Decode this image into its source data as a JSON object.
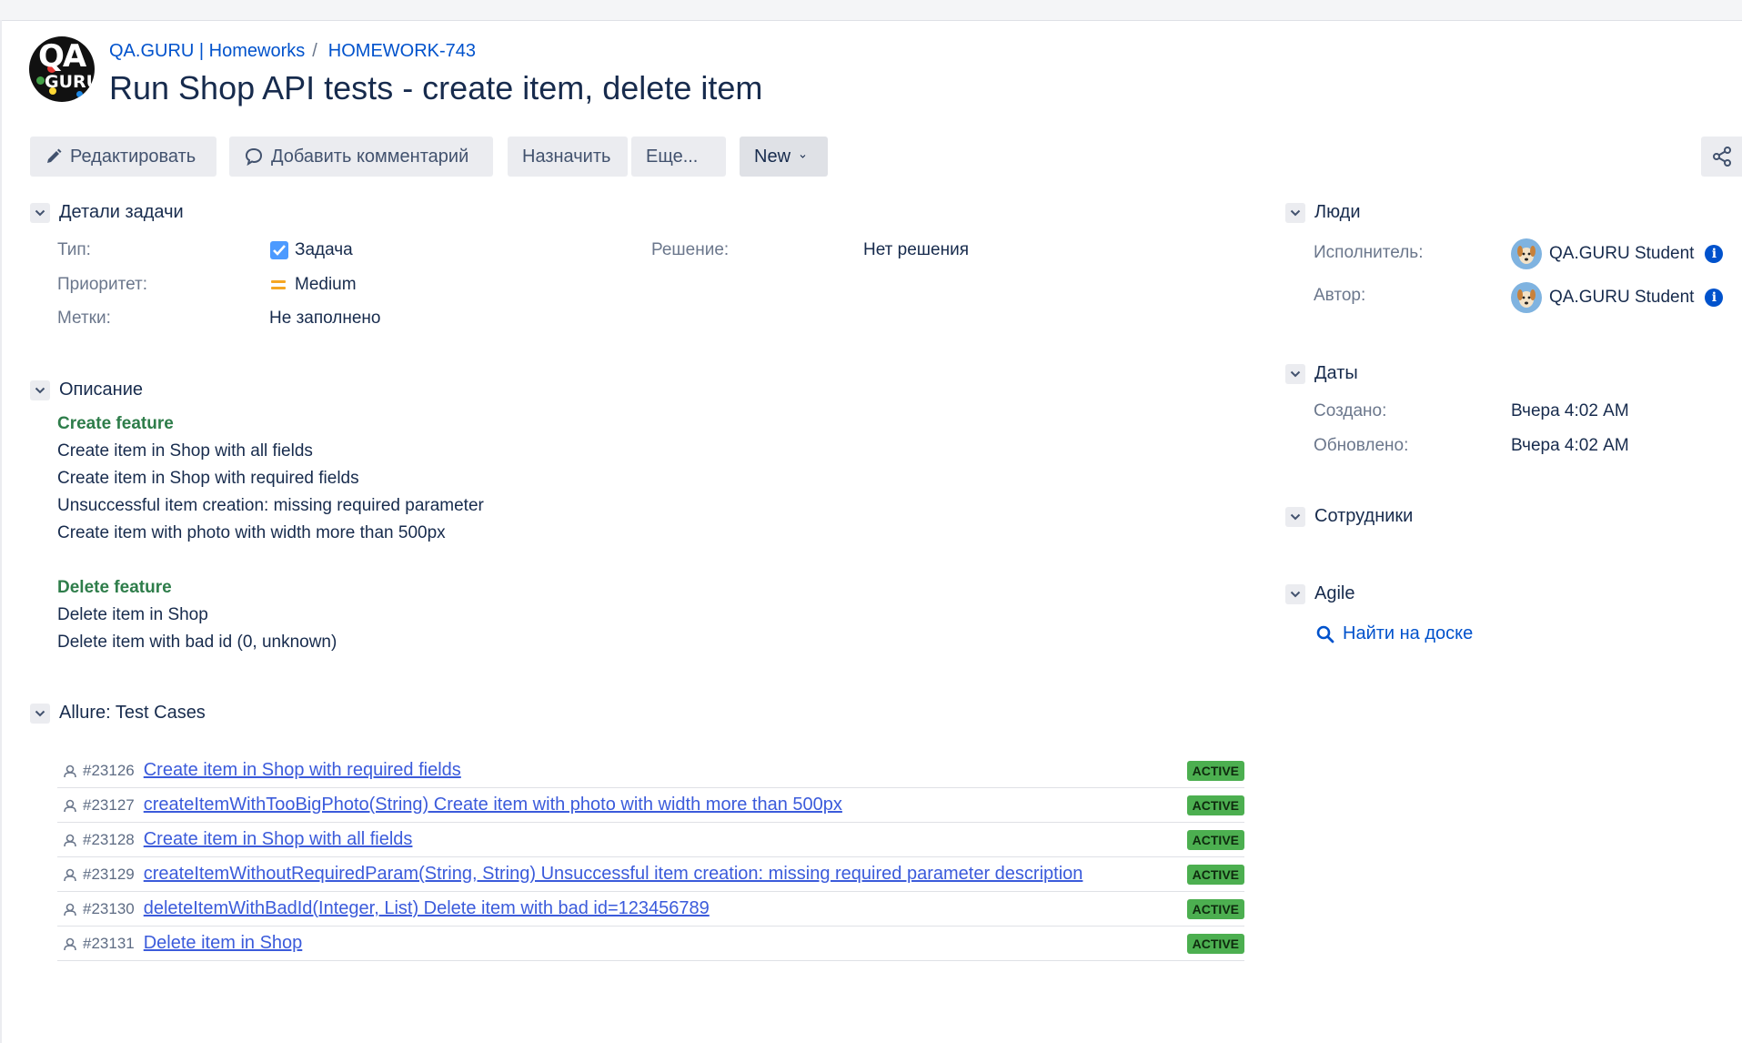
{
  "header": {
    "project": "QA.GURU | Homeworks",
    "separator": "/",
    "issue_key": "HOMEWORK-743",
    "title": "Run Shop API tests - create item, delete item",
    "logo_text_top": "QA",
    "logo_text_bottom": "GURU"
  },
  "toolbar": {
    "edit": "Редактировать",
    "comment": "Добавить комментарий",
    "assign": "Назначить",
    "more": "Еще...",
    "status": "New"
  },
  "details": {
    "header": "Детали задачи",
    "type_label": "Тип:",
    "type_value": "Задача",
    "priority_label": "Приоритет:",
    "priority_value": "Medium",
    "labels_label": "Метки:",
    "labels_value": "Не заполнено",
    "resolution_label": "Решение:",
    "resolution_value": "Нет решения"
  },
  "description": {
    "header": "Описание",
    "create_title": "Create feature",
    "create_lines": [
      "Create item in Shop with all fields",
      "Create item in Shop with required fields",
      "Unsuccessful item creation: missing required parameter",
      "Create item with photo with width more than 500px"
    ],
    "delete_title": "Delete feature",
    "delete_lines": [
      "Delete item in Shop",
      "Delete item with bad id (0, unknown)"
    ]
  },
  "allure": {
    "header": "Allure: Test Cases",
    "rows": [
      {
        "id": "#23126",
        "name": "Create item in Shop with required fields",
        "status": "ACTIVE"
      },
      {
        "id": "#23127",
        "name": "createItemWithTooBigPhoto(String) Create item with photo with width more than 500px",
        "status": "ACTIVE"
      },
      {
        "id": "#23128",
        "name": "Create item in Shop with all fields",
        "status": "ACTIVE"
      },
      {
        "id": "#23129",
        "name": "createItemWithoutRequiredParam(String, String) Unsuccessful item creation: missing required parameter description",
        "status": "ACTIVE"
      },
      {
        "id": "#23130",
        "name": "deleteItemWithBadId(Integer, List) Delete item with bad id=123456789",
        "status": "ACTIVE"
      },
      {
        "id": "#23131",
        "name": "Delete item in Shop",
        "status": "ACTIVE"
      }
    ]
  },
  "people": {
    "header": "Люди",
    "assignee_label": "Исполнитель:",
    "assignee_value": "QA.GURU Student",
    "reporter_label": "Автор:",
    "reporter_value": "QA.GURU Student"
  },
  "dates": {
    "header": "Даты",
    "created_label": "Создано:",
    "created_value": "Вчера 4:02 AM",
    "updated_label": "Обновлено:",
    "updated_value": "Вчера 4:02 AM"
  },
  "employees": {
    "header": "Сотрудники"
  },
  "agile": {
    "header": "Agile",
    "find_link": "Найти на доске"
  },
  "colors": {
    "link": "#0052cc",
    "badge": "#4caf50",
    "feature_title": "#2e7d4a",
    "priority": "#f5a623"
  }
}
